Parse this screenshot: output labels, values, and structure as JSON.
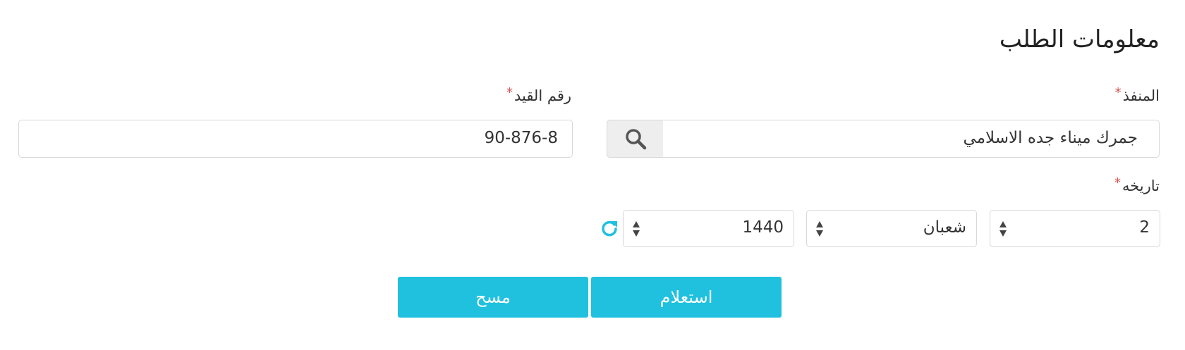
{
  "page": {
    "title": "معلومات الطلب"
  },
  "port": {
    "label": "المنفذ",
    "required_mark": "*",
    "value": "جمرك ميناء جده الاسلامي",
    "search_icon": "search-icon"
  },
  "registration": {
    "label": "رقم القيد",
    "required_mark": "*",
    "value": "90-876-8"
  },
  "date": {
    "label": "تاريخه",
    "required_mark": "*",
    "day": "2",
    "month": "شعبان",
    "year": "1440",
    "reset_icon": "refresh-icon"
  },
  "actions": {
    "inquiry_label": "استعلام",
    "clear_label": "مسح"
  },
  "colors": {
    "accent": "#1fc1de",
    "required": "#d9534f"
  }
}
